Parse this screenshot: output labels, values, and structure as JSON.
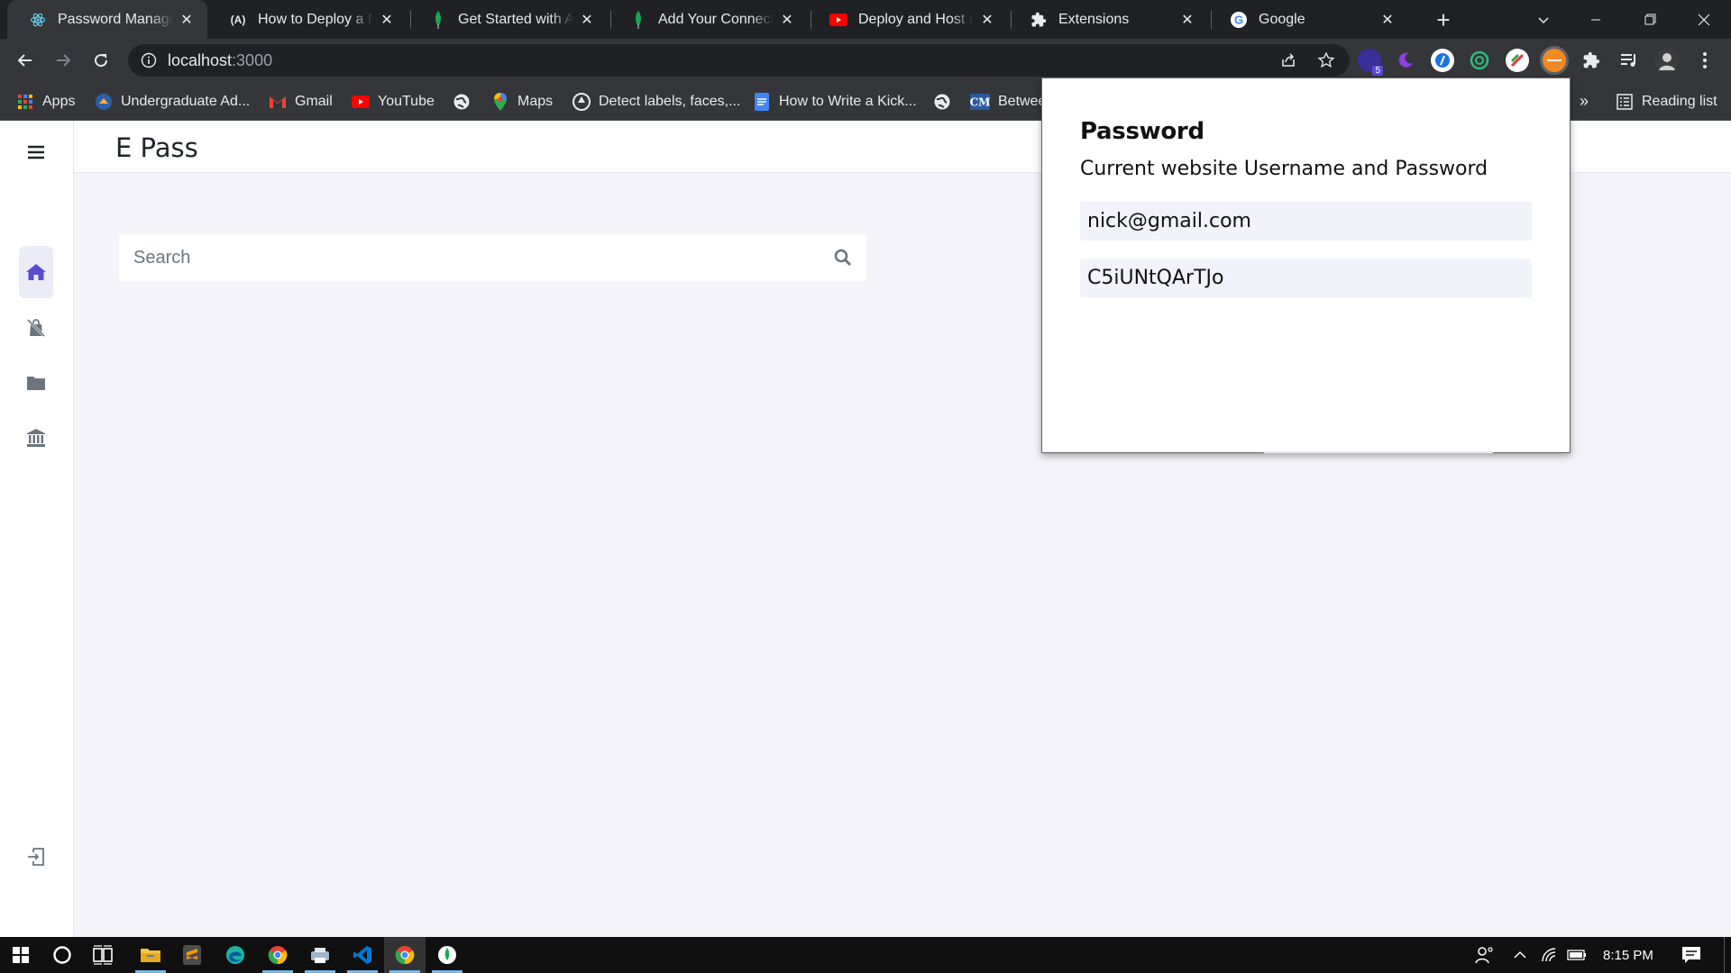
{
  "browser": {
    "tabs": [
      {
        "title": "Password Manager",
        "icon": "react-icon",
        "active": true
      },
      {
        "title": "How to Deploy a ML",
        "icon": "analytics-vidhya-icon",
        "active": false
      },
      {
        "title": "Get Started with Atlas",
        "icon": "mongodb-leaf-icon",
        "active": false
      },
      {
        "title": "Add Your Connection",
        "icon": "mongodb-leaf-icon",
        "active": false
      },
      {
        "title": "Deploy and Host a F",
        "icon": "youtube-icon",
        "active": false
      },
      {
        "title": "Extensions",
        "icon": "puzzle-icon",
        "active": false
      },
      {
        "title": "Google",
        "icon": "google-icon",
        "active": false
      }
    ],
    "close_glyph": "✕",
    "new_tab_glyph": "+",
    "url_host": "localhost",
    "url_port": ":3000",
    "extension_badge": "5",
    "bookmarks": [
      {
        "label": "Apps",
        "icon": "apps-grid-icon"
      },
      {
        "label": "Undergraduate Ad...",
        "icon": "university-icon"
      },
      {
        "label": "Gmail",
        "icon": "gmail-icon"
      },
      {
        "label": "YouTube",
        "icon": "youtube-icon"
      },
      {
        "label": "",
        "icon": "globe-icon"
      },
      {
        "label": "Maps",
        "icon": "maps-icon"
      },
      {
        "label": "Detect labels, faces,...",
        "icon": "google-cloud-icon"
      },
      {
        "label": "How to Write a Kick...",
        "icon": "docs-icon"
      },
      {
        "label": "",
        "icon": "globe-icon"
      },
      {
        "label": "Betwee",
        "icon": "cm-icon"
      }
    ],
    "more_bookmarks": "»",
    "reading_list": "Reading list"
  },
  "app": {
    "brand": "E Pass",
    "search_placeholder": "Search",
    "sidebar_items": [
      {
        "name": "home",
        "icon": "home-icon",
        "active": true
      },
      {
        "name": "no-bag",
        "icon": "shopping-bag-slash-icon",
        "active": false
      },
      {
        "name": "folder",
        "icon": "folder-icon",
        "active": false
      },
      {
        "name": "bank",
        "icon": "bank-icon",
        "active": false
      }
    ],
    "logout_icon": "logout-icon"
  },
  "popup": {
    "title": "Password",
    "subtitle": "Current website Username and Password",
    "username": "nick@gmail.com",
    "password": "C5iUNtQArTJo"
  },
  "taskbar": {
    "time": "8:15 PM"
  },
  "colors": {
    "accent": "#5b4bd0",
    "page_bg": "#f3f3f9",
    "chrome_dark": "#202124",
    "chrome_mid": "#35363a"
  }
}
